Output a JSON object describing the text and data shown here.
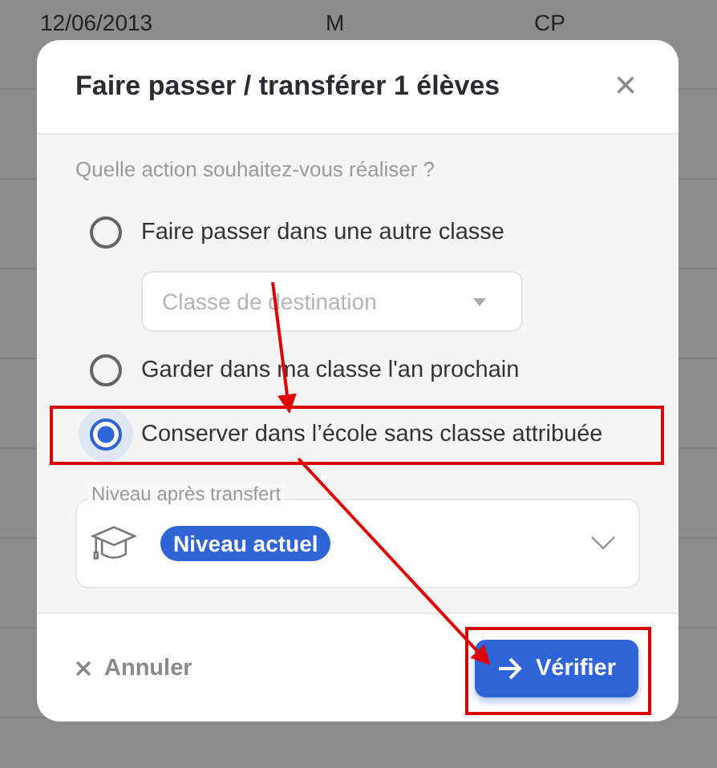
{
  "background_table": {
    "rows": [
      {
        "cells": [
          "12/06/2013",
          "M",
          "CP"
        ]
      }
    ]
  },
  "dialog": {
    "title": "Faire passer / transférer 1 élèves",
    "close": "×",
    "question": "Quelle action souhaitez-vous réaliser ?",
    "options": [
      {
        "label": "Faire passer dans une autre classe",
        "selected": false,
        "highlighted": false,
        "select": {
          "placeholder": "Classe de destination"
        }
      },
      {
        "label": "Garder dans ma classe l'an prochain",
        "selected": false,
        "highlighted": false
      },
      {
        "label": "Conserver dans l’école sans classe attribuée",
        "selected": true,
        "highlighted": true
      }
    ],
    "level_field": {
      "label": "Niveau après transfert",
      "value": "Niveau actuel"
    },
    "buttons": [
      {
        "label": "Annuler",
        "kind": "cancel",
        "highlighted": false
      },
      {
        "label": "Vérifier",
        "kind": "primary",
        "highlighted": true
      }
    ]
  }
}
